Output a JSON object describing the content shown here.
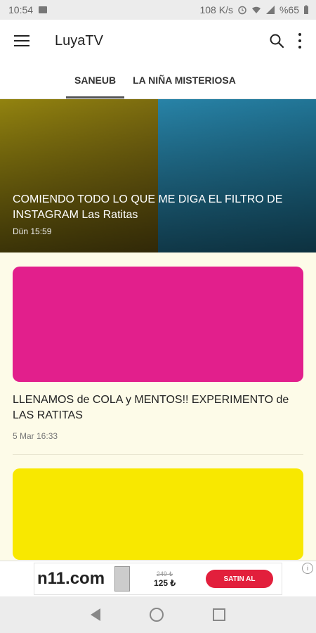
{
  "status": {
    "time": "10:54",
    "net_speed": "108 K/s",
    "battery": "%65"
  },
  "app": {
    "title": "LuyaTV"
  },
  "tabs": [
    {
      "label": "SANEUB",
      "active": true
    },
    {
      "label": "LA NIÑA MISTERIOSA",
      "active": false
    }
  ],
  "hero": {
    "title": "COMIENDO TODO LO QUE ME DIGA EL FILTRO DE INSTAGRAM Las Ratitas",
    "date": "Dün 15:59"
  },
  "videos": [
    {
      "title": "LLENAMOS de COLA y MENTOS!! EXPERIMENTO de LAS RATITAS",
      "date": "5 Mar 16:33"
    }
  ],
  "ad": {
    "brand": "n11.com",
    "old_price": "249 ₺",
    "new_price": "125 ₺",
    "cta": "SATIN AL"
  },
  "colors": {
    "background": "#fdfbe8",
    "ad_accent": "#e21f3c",
    "card1_bg": "#e21f8c",
    "card2_bg": "#f8e800"
  }
}
